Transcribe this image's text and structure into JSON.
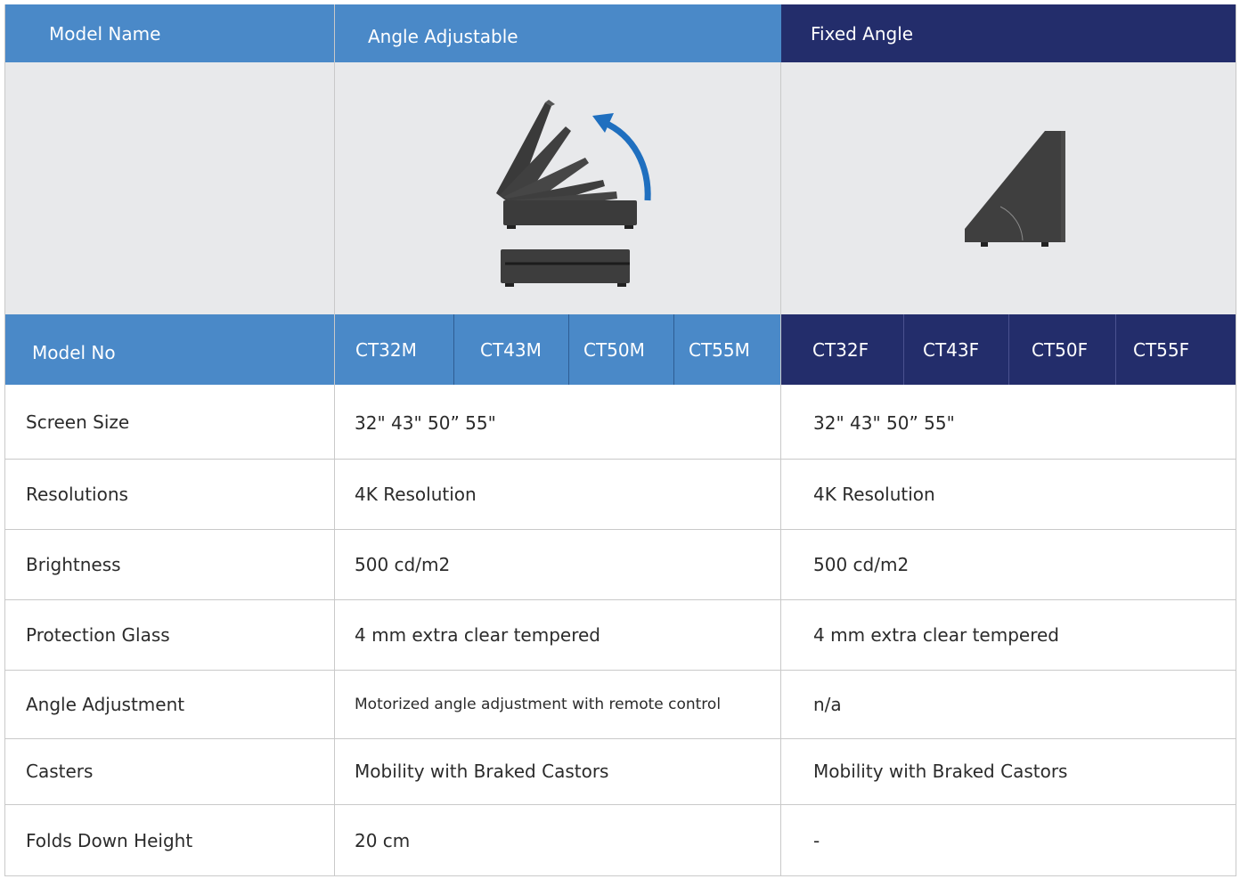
{
  "header": {
    "model_name_label": "Model Name",
    "angle_adjustable": "Angle Adjustable",
    "fixed_angle": "Fixed Angle"
  },
  "model_no": {
    "label": "Model No",
    "adjustable": [
      "CT32M",
      "CT43M",
      "CT50M",
      "CT55M"
    ],
    "fixed": [
      "CT32F",
      "CT43F",
      "CT50F",
      "CT55F"
    ]
  },
  "rows": [
    {
      "label": "Screen Size",
      "adjustable": "32\" 43\" 50” 55\"",
      "fixed": "32\" 43\" 50” 55\""
    },
    {
      "label": "Resolutions",
      "adjustable": "4K Resolution",
      "fixed": "4K Resolution"
    },
    {
      "label": "Brightness",
      "adjustable": "500 cd/m2",
      "fixed": "500 cd/m2"
    },
    {
      "label": "Protection Glass",
      "adjustable": "4 mm extra clear tempered",
      "fixed": "4 mm extra clear tempered"
    },
    {
      "label": "Angle Adjustment",
      "adjustable": "Motorized angle adjustment with remote control",
      "fixed": "n/a"
    },
    {
      "label": "Casters",
      "adjustable": "Mobility with Braked Castors",
      "fixed": "Mobility with Braked Castors"
    },
    {
      "label": "Folds Down Height",
      "adjustable": "20 cm",
      "fixed": "-"
    }
  ],
  "colors": {
    "header_light": "#4a89c8",
    "header_dark": "#232d6b",
    "image_bg": "#e8e9eb",
    "arrow": "#1f6fbf"
  },
  "images": {
    "adjustable": "product-angle-adjustable-illustration",
    "fixed": "product-fixed-angle-illustration"
  }
}
